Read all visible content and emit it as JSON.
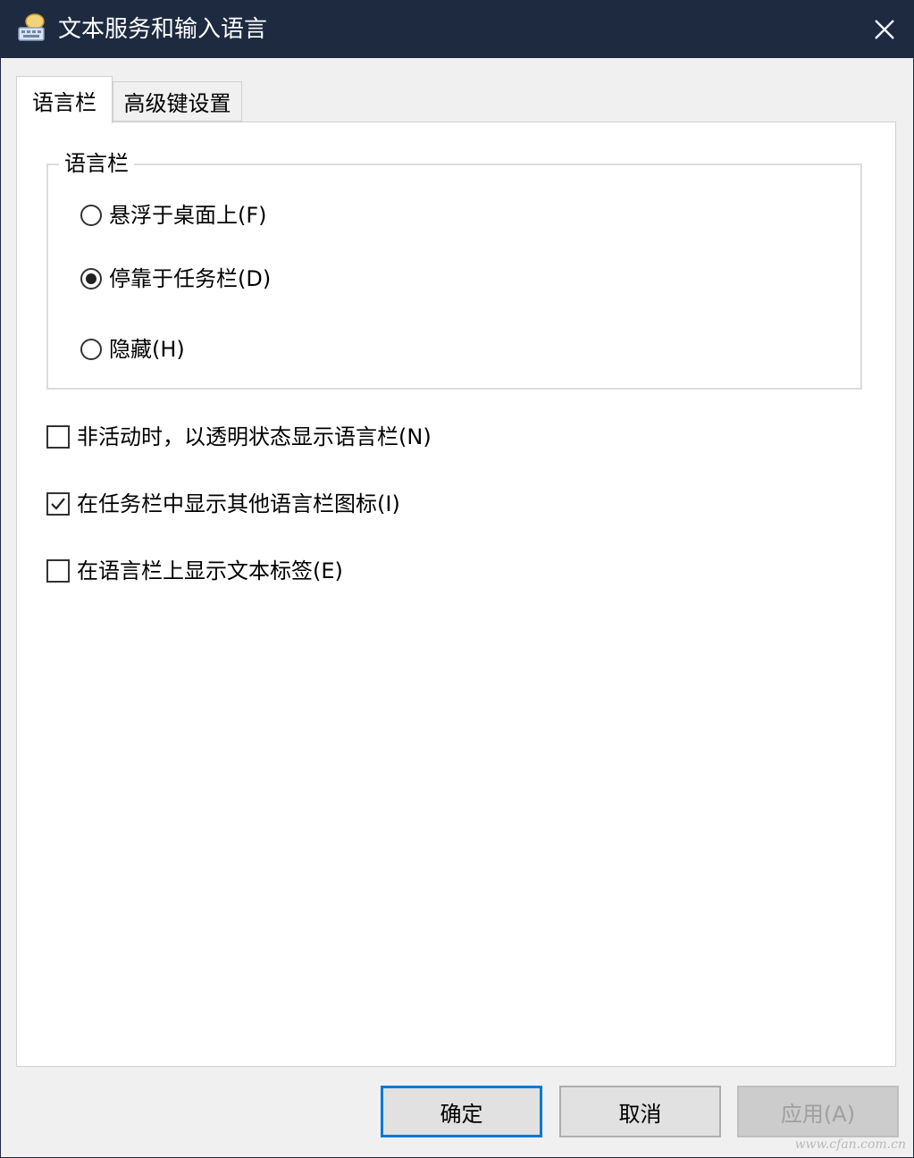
{
  "window": {
    "title": "文本服务和输入语言",
    "title_icon": "keyboard-language-icon",
    "close_icon": "close-icon"
  },
  "tabs": [
    {
      "label": "语言栏",
      "active": true
    },
    {
      "label": "高级键设置",
      "active": false
    }
  ],
  "language_bar_group": {
    "legend": "语言栏",
    "options": [
      {
        "label": "悬浮于桌面上(F)",
        "selected": false
      },
      {
        "label": "停靠于任务栏(D)",
        "selected": true
      },
      {
        "label": "隐藏(H)",
        "selected": false
      }
    ]
  },
  "checkboxes": [
    {
      "label": "非活动时，以透明状态显示语言栏(N)",
      "checked": false
    },
    {
      "label": "在任务栏中显示其他语言栏图标(I)",
      "checked": true
    },
    {
      "label": "在语言栏上显示文本标签(E)",
      "checked": false
    }
  ],
  "buttons": {
    "ok": "确定",
    "cancel": "取消",
    "apply": "应用(A)",
    "apply_enabled": false
  },
  "watermark": "www.cfan.com.cn",
  "colors": {
    "titlebar": "#1d2a40",
    "focus_border": "#0078d7",
    "disabled_text": "#a0a0a0"
  }
}
